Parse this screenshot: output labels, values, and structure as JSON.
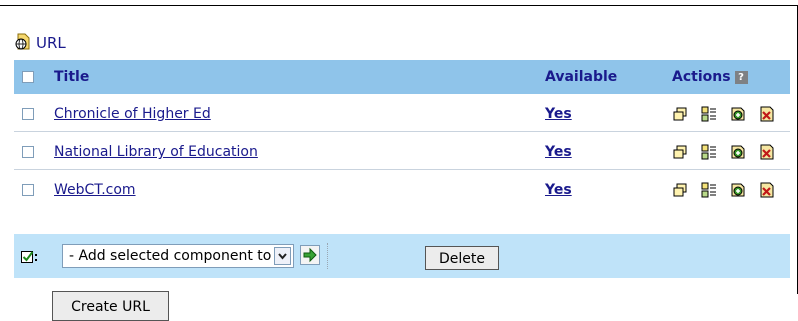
{
  "component": {
    "title": "URL",
    "icon": "globe-doc-icon"
  },
  "table": {
    "columns": {
      "title": "Title",
      "available": "Available",
      "actions": "Actions",
      "help": "?"
    },
    "rows": [
      {
        "title": "Chronicle of Higher Ed",
        "available": "Yes"
      },
      {
        "title": "National Library of Education",
        "available": "Yes"
      },
      {
        "title": "WebCT.com",
        "available": "Yes"
      }
    ],
    "row_actions": [
      "edit-icon",
      "properties-icon",
      "add-icon",
      "delete-icon"
    ]
  },
  "footer": {
    "select_value": "- Add selected component to -",
    "delete_label": "Delete"
  },
  "create_button": "Create URL"
}
